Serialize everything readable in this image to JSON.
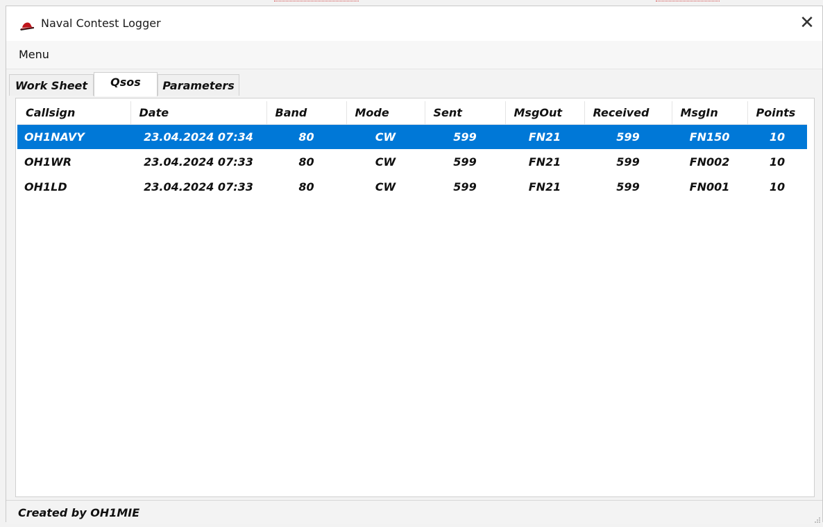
{
  "window": {
    "title": "Naval Contest Logger",
    "close_glyph": "✕",
    "icon": "red-hat-app-icon"
  },
  "menu": {
    "items": [
      {
        "label": "Menu"
      }
    ]
  },
  "tabs": [
    {
      "label": "Work Sheet",
      "active": false
    },
    {
      "label": "Qsos",
      "active": true
    },
    {
      "label": "Parameters",
      "active": false
    }
  ],
  "table": {
    "columns": [
      "Callsign",
      "Date",
      "Band",
      "Mode",
      "Sent",
      "MsgOut",
      "Received",
      "MsgIn",
      "Points"
    ],
    "rows": [
      {
        "callsign": "OH1NAVY",
        "date": "23.04.2024 07:34",
        "band": "80",
        "mode": "CW",
        "sent": "599",
        "msgout": "FN21",
        "received": "599",
        "msgin": "FN150",
        "points": "10",
        "selected": true
      },
      {
        "callsign": "OH1WR",
        "date": "23.04.2024 07:33",
        "band": "80",
        "mode": "CW",
        "sent": "599",
        "msgout": "FN21",
        "received": "599",
        "msgin": "FN002",
        "points": "10",
        "selected": false
      },
      {
        "callsign": "OH1LD",
        "date": "23.04.2024 07:33",
        "band": "80",
        "mode": "CW",
        "sent": "599",
        "msgout": "FN21",
        "received": "599",
        "msgin": "FN001",
        "points": "10",
        "selected": false
      }
    ]
  },
  "status": {
    "text": "Created by OH1MIE"
  },
  "colors": {
    "selection": "#0078d7",
    "selection_text": "#ffffff"
  }
}
